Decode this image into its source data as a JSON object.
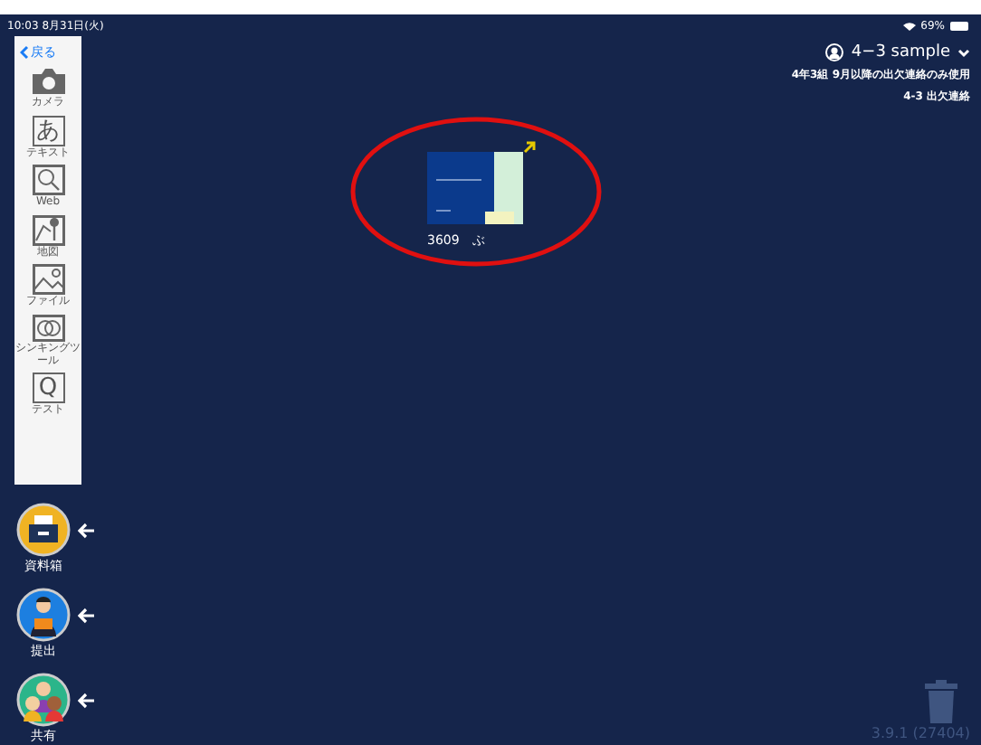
{
  "status_bar": {
    "time": "10:03  8月31日(火)",
    "battery": "69%"
  },
  "sidebar": {
    "back": "戻る",
    "tools": [
      {
        "kind": "camera",
        "label": "カメラ"
      },
      {
        "kind": "text",
        "label": "テキスト",
        "glyph": "あ"
      },
      {
        "kind": "web",
        "label": "Web"
      },
      {
        "kind": "map",
        "label": "地図"
      },
      {
        "kind": "file",
        "label": "ファイル"
      },
      {
        "kind": "thinking",
        "label": "シンキングツール"
      },
      {
        "kind": "test",
        "label": "テスト",
        "glyph": "Q"
      }
    ]
  },
  "boxes": [
    {
      "kind": "materials",
      "label": "資料箱"
    },
    {
      "kind": "submit",
      "label": "提出"
    },
    {
      "kind": "share",
      "label": "共有"
    }
  ],
  "account": {
    "name": "4−3 sample",
    "lines": [
      "4年3組 9月以降の出欠連絡のみ使用",
      "4-3 出欠連絡"
    ]
  },
  "card": {
    "caption": "3609　ぶ"
  },
  "version": "3.9.1 (27404)"
}
